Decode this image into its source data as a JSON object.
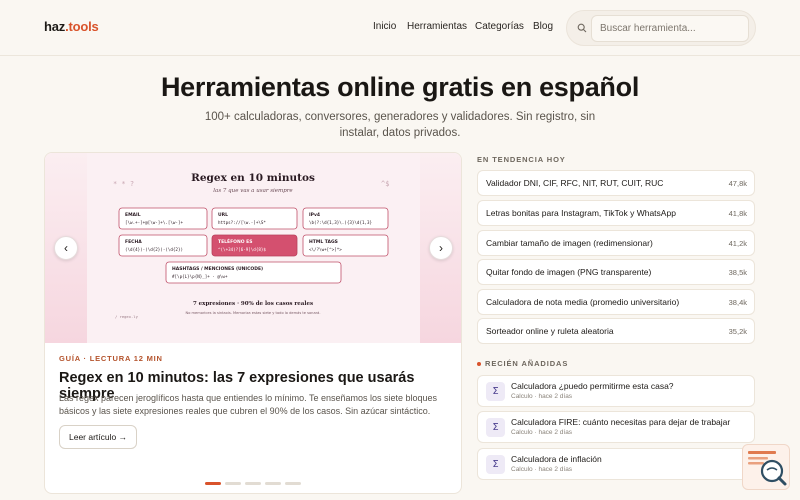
{
  "header": {
    "logo_main": "haz",
    "logo_dot": ".",
    "logo_tools": "tools",
    "nav": [
      "Inicio",
      "Herramientas",
      "Categorías",
      "Blog"
    ],
    "search_placeholder": "Buscar herramienta..."
  },
  "hero": {
    "title": "Herramientas online gratis en español",
    "subtitle": "100+ calculadoras, conversores, generadores y validadores. Sin registro, sin instalar, datos privados."
  },
  "feature": {
    "image": {
      "title": "Regex en 10 minutos",
      "subtitle": "las 7 que vas a usar siempre",
      "deco_left": "* * ?",
      "deco_right": "^$",
      "boxes": [
        {
          "label": "EMAIL",
          "code": "[\\w.+-]+@[\\w-]+\\.[\\w-]+"
        },
        {
          "label": "URL",
          "code": "https?://[\\w.-]+\\S*"
        },
        {
          "label": "IPv4",
          "code": "\\b(?:\\d{1,3}\\.){3}\\d{1,3}"
        },
        {
          "label": "FECHA",
          "code": "(\\d{4})-(\\d{2})-(\\d{2})"
        },
        {
          "label": "TELÉFONO ES",
          "code": "^(\\+34)?[6-9]\\d{8}$"
        },
        {
          "label": "HTML TAGS",
          "code": "<\\/?\\w+[^>]*>"
        },
        {
          "label": "HASHTAGS / MENCIONES (UNICODE)",
          "code": "#[\\p{L}\\p{N}_]+ · @\\w+"
        }
      ],
      "footer": "7 expresiones · 90% de los casos reales",
      "footnote": "No memorices la sintaxis. Memoriza estas siete y todo lo demás te sonará.",
      "corner": "/ regex.ly"
    },
    "category": "GUÍA · LECTURA 12 MIN",
    "title": "Regex en 10 minutos: las 7 expresiones que usarás siempre",
    "description": "Las regex parecen jeroglíficos hasta que entiendes lo mínimo. Te enseñamos los siete bloques básicos y las siete expresiones reales que cubren el 90% de los casos. Sin azúcar sintáctico.",
    "cta": "Leer artículo →",
    "prev": "‹",
    "next": "›",
    "slides": 5,
    "active_slide": 0
  },
  "trending": {
    "label": "EN TENDENCIA HOY",
    "items": [
      {
        "label": "Validador DNI, CIF, RFC, NIT, RUT, CUIT, RUC",
        "count": "47,8k"
      },
      {
        "label": "Letras bonitas para Instagram, TikTok y WhatsApp",
        "count": "41,8k"
      },
      {
        "label": "Cambiar tamaño de imagen (redimensionar)",
        "count": "41,2k"
      },
      {
        "label": "Quitar fondo de imagen (PNG transparente)",
        "count": "38,5k"
      },
      {
        "label": "Calculadora de nota media (promedio universitario)",
        "count": "38,4k"
      },
      {
        "label": "Sorteador online y ruleta aleatoria",
        "count": "35,2k"
      }
    ]
  },
  "recent": {
    "label": "RECIÉN AÑADIDAS",
    "icon": "Σ",
    "items": [
      {
        "title": "Calculadora ¿puedo permitirme esta casa?",
        "meta": "Calculo · hace 2 días"
      },
      {
        "title": "Calculadora FIRE: cuánto necesitas para dejar de trabajar",
        "meta": "Calculo · hace 2 días"
      },
      {
        "title": "Calculadora de inflación",
        "meta": "Calculo · hace 2 días"
      }
    ]
  },
  "colors": {
    "accent": "#d9532b",
    "background": "#faf7f2"
  }
}
